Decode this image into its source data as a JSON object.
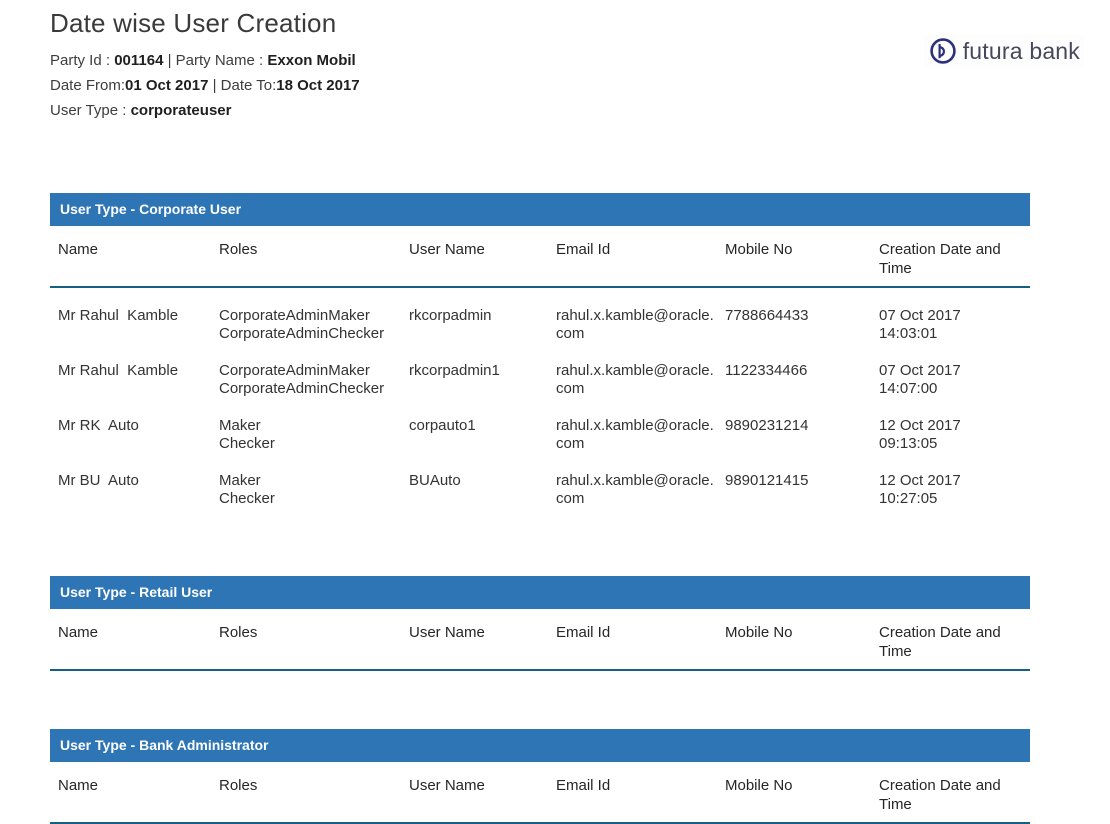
{
  "header": {
    "title": "Date wise User Creation",
    "party_id_label": "Party Id : ",
    "party_id": "001164",
    "party_name_label": " | Party Name : ",
    "party_name": "Exxon Mobil",
    "date_from_label": "Date From:",
    "date_from": "01 Oct 2017",
    "date_to_label": " | Date To:",
    "date_to": "18 Oct 2017",
    "user_type_label": "User Type : ",
    "user_type": "corporateuser",
    "logo_text": "futura bank"
  },
  "columns": [
    "Name",
    "Roles",
    "User Name",
    "Email Id",
    "Mobile No",
    "Creation Date and Time"
  ],
  "tables": [
    {
      "title": "User Type - Corporate User",
      "rows": [
        {
          "name": "Mr Rahul  Kamble",
          "roles": [
            "CorporateAdminMaker",
            "CorporateAdminChecker"
          ],
          "user_name": "rkcorpadmin",
          "email": [
            "rahul.x.kamble@oracle.",
            "com"
          ],
          "mobile": "7788664433",
          "created": [
            "07 Oct 2017",
            "14:03:01"
          ]
        },
        {
          "name": "Mr Rahul  Kamble",
          "roles": [
            "CorporateAdminMaker",
            "CorporateAdminChecker"
          ],
          "user_name": "rkcorpadmin1",
          "email": [
            "rahul.x.kamble@oracle.",
            "com"
          ],
          "mobile": "1122334466",
          "created": [
            "07 Oct 2017",
            "14:07:00"
          ]
        },
        {
          "name": "Mr RK  Auto",
          "roles": [
            "Maker",
            "Checker"
          ],
          "user_name": "corpauto1",
          "email": [
            "rahul.x.kamble@oracle.",
            "com"
          ],
          "mobile": "9890231214",
          "created": [
            "12 Oct 2017",
            "09:13:05"
          ]
        },
        {
          "name": "Mr BU  Auto",
          "roles": [
            "Maker",
            "Checker"
          ],
          "user_name": "BUAuto",
          "email": [
            "rahul.x.kamble@oracle.",
            "com"
          ],
          "mobile": "9890121415",
          "created": [
            "12 Oct 2017",
            "10:27:05"
          ]
        }
      ]
    },
    {
      "title": "User Type - Retail User",
      "rows": []
    },
    {
      "title": "User Type - Bank Administrator",
      "rows": []
    }
  ],
  "colors": {
    "table_header_bg": "#2e75b6",
    "header_rule": "#156082",
    "logo_navy": "#2d2f7f",
    "title_text": "#3a3a3a"
  }
}
